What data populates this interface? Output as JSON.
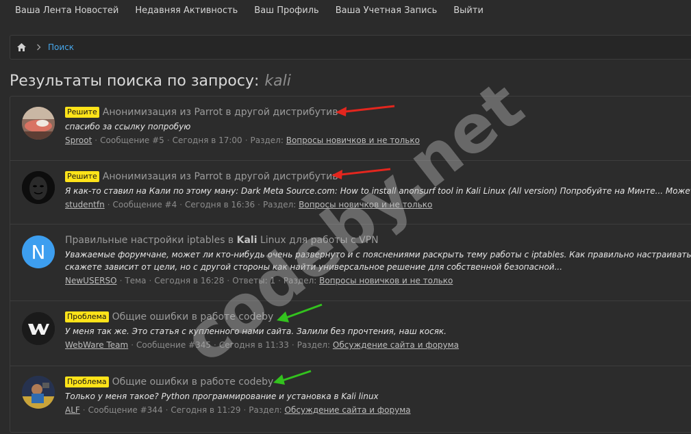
{
  "topnav": {
    "items": [
      "Ваша Лента Новостей",
      "Недавняя Активность",
      "Ваш Профиль",
      "Ваша Учетная Запись",
      "Выйти"
    ]
  },
  "breadcrumb": {
    "home_icon": "home-icon",
    "link": "Поиск"
  },
  "page": {
    "title": "Результаты поиска по запросу:",
    "query": "kali"
  },
  "colors": {
    "prefix_resolved": "#ffe319",
    "prefix_problem": "#ffe319",
    "link_blue": "#47a7eb",
    "arrow_red": "#e3261e",
    "arrow_green": "#33c21e"
  },
  "results": [
    {
      "prefix": "Решите",
      "title_before": "Анонимизация из Parrot в другой дистрибутив",
      "title_bold": "",
      "title_after": "",
      "snippet": "спасибо за ссылку попробую",
      "author": "Sproot",
      "type": "Сообщение #5",
      "time": "Сегодня в 17:00",
      "replies": "",
      "section_label": "Раздел:",
      "section": "Вопросы новичков и не только"
    },
    {
      "prefix": "Решите",
      "title_before": "Анонимизация из Parrot в другой дистрибутив",
      "title_bold": "",
      "title_after": "",
      "snippet": "Я как-то ставил на Кали по этому ману: Dark Meta Source.com: How to install anonsurf tool in Kali Linux (All version) Попробуйте на Минте... Может и пол",
      "author": "studentfn",
      "type": "Сообщение #4",
      "time": "Сегодня в 16:36",
      "replies": "",
      "section_label": "Раздел:",
      "section": "Вопросы новичков и не только"
    },
    {
      "prefix": "",
      "title_before": "Правильные настройки iptables в ",
      "title_bold": "Kali",
      "title_after": " Linux для работы с VPN",
      "snippet_line1": "Уважаемые форумчане, может ли кто-нибудь очень развернуто и с пояснениями раскрыть тему работы с iptables. Как правильно настраивать? Есть",
      "snippet_line2": "скажете зависит от цели, но с другой стороны как найти универсальное решение для собственной безопасной...",
      "author": "NewUSERSO",
      "type": "Тема",
      "time": "Сегодня в 16:28",
      "replies": "Ответы: 1",
      "section_label": "Раздел:",
      "section": "Вопросы новичков и не только",
      "avatar_letter": "N"
    },
    {
      "prefix": "Проблема",
      "title_before": "Общие ошибки в работе codeby",
      "title_bold": "",
      "title_after": "",
      "snippet": "У меня так же. Это статья с купленного нами сайта. Залили без прочтения, наш косяк.",
      "author": "WebWare Team",
      "type": "Сообщение #345",
      "time": "Сегодня в 11:33",
      "replies": "",
      "section_label": "Раздел:",
      "section": "Обсуждение сайта и форума"
    },
    {
      "prefix": "Проблема",
      "title_before": "Общие ошибки в работе codeby",
      "title_bold": "",
      "title_after": "",
      "snippet": "Только у меня такое? Python программирование и установка в Kali linux",
      "author": "ALF",
      "type": "Сообщение #344",
      "time": "Сегодня в 11:29",
      "replies": "",
      "section_label": "Раздел:",
      "section": "Обсуждение сайта и форума"
    }
  ],
  "watermark": "codeby.net"
}
